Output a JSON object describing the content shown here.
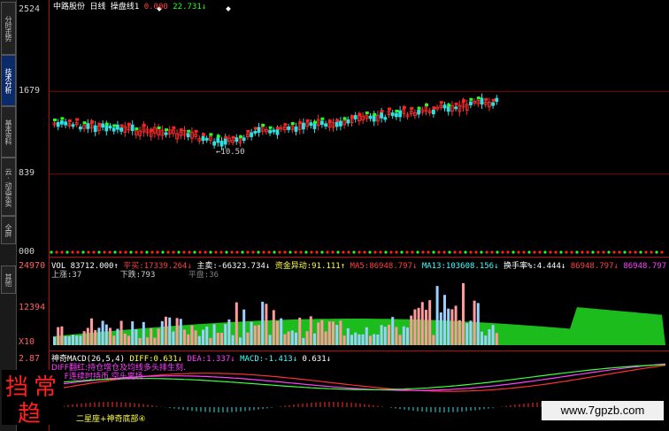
{
  "sidebar": {
    "tabs": [
      {
        "label": "分时走势",
        "active": false
      },
      {
        "label": "技术分析",
        "active": true
      },
      {
        "label": "基本资料",
        "active": false
      },
      {
        "label": "云·动态买卖",
        "active": false
      },
      {
        "label": "全屏",
        "active": false
      },
      {
        "label": "其他",
        "active": false
      }
    ]
  },
  "price_axis": {
    "labels": [
      "2524",
      "1679",
      "839",
      "000"
    ]
  },
  "volume_axis": {
    "labels": [
      "24970",
      "12394",
      "X10"
    ]
  },
  "macd_axis": {
    "labels": [
      "2.87"
    ]
  },
  "header": {
    "stock_name": "中路股份",
    "period": "日线",
    "indicator": "操盘线1",
    "value": "0.000",
    "value2": "22.731↓"
  },
  "price_annotation": "←10.50",
  "vol_bar": {
    "vol": "VOL 83712.000↑",
    "buy": "平买:17339.264↓",
    "main_sell": "主卖:-66323.734↓",
    "fund": "资金异动:91.111↑",
    "ma5": "MA5:86948.797↓",
    "ma13": "MA13:103608.156↓",
    "turnover": "换手率%:4.444↓",
    "extra1": "86948.797↓",
    "extra2": "86948.797"
  },
  "vol_bar2": {
    "up": "上涨:37",
    "down": "下跌:793",
    "flat": "平盘:36"
  },
  "macd_bar": {
    "name": "神奇MACD(26,5,4)",
    "diff": "DIFF:0.631↓",
    "dea": "DEA:1.337↓",
    "macd": "MACD:-1.413↓",
    "extra": "0.631↓"
  },
  "macd_notes": [
    "DIFF翻红:持仓增仓及均线多头排生刻.",
    "DIFF连续时持币,空头离场."
  ],
  "bottom_signal": "二星座+神奇底部④",
  "logo_text": [
    "挡",
    "常",
    "趋"
  ],
  "watermark": "www.7gpzb.com",
  "colors": {
    "up": "#ff3030",
    "down": "#30e0e0",
    "green": "#20ff20",
    "axis": "#b01010"
  }
}
